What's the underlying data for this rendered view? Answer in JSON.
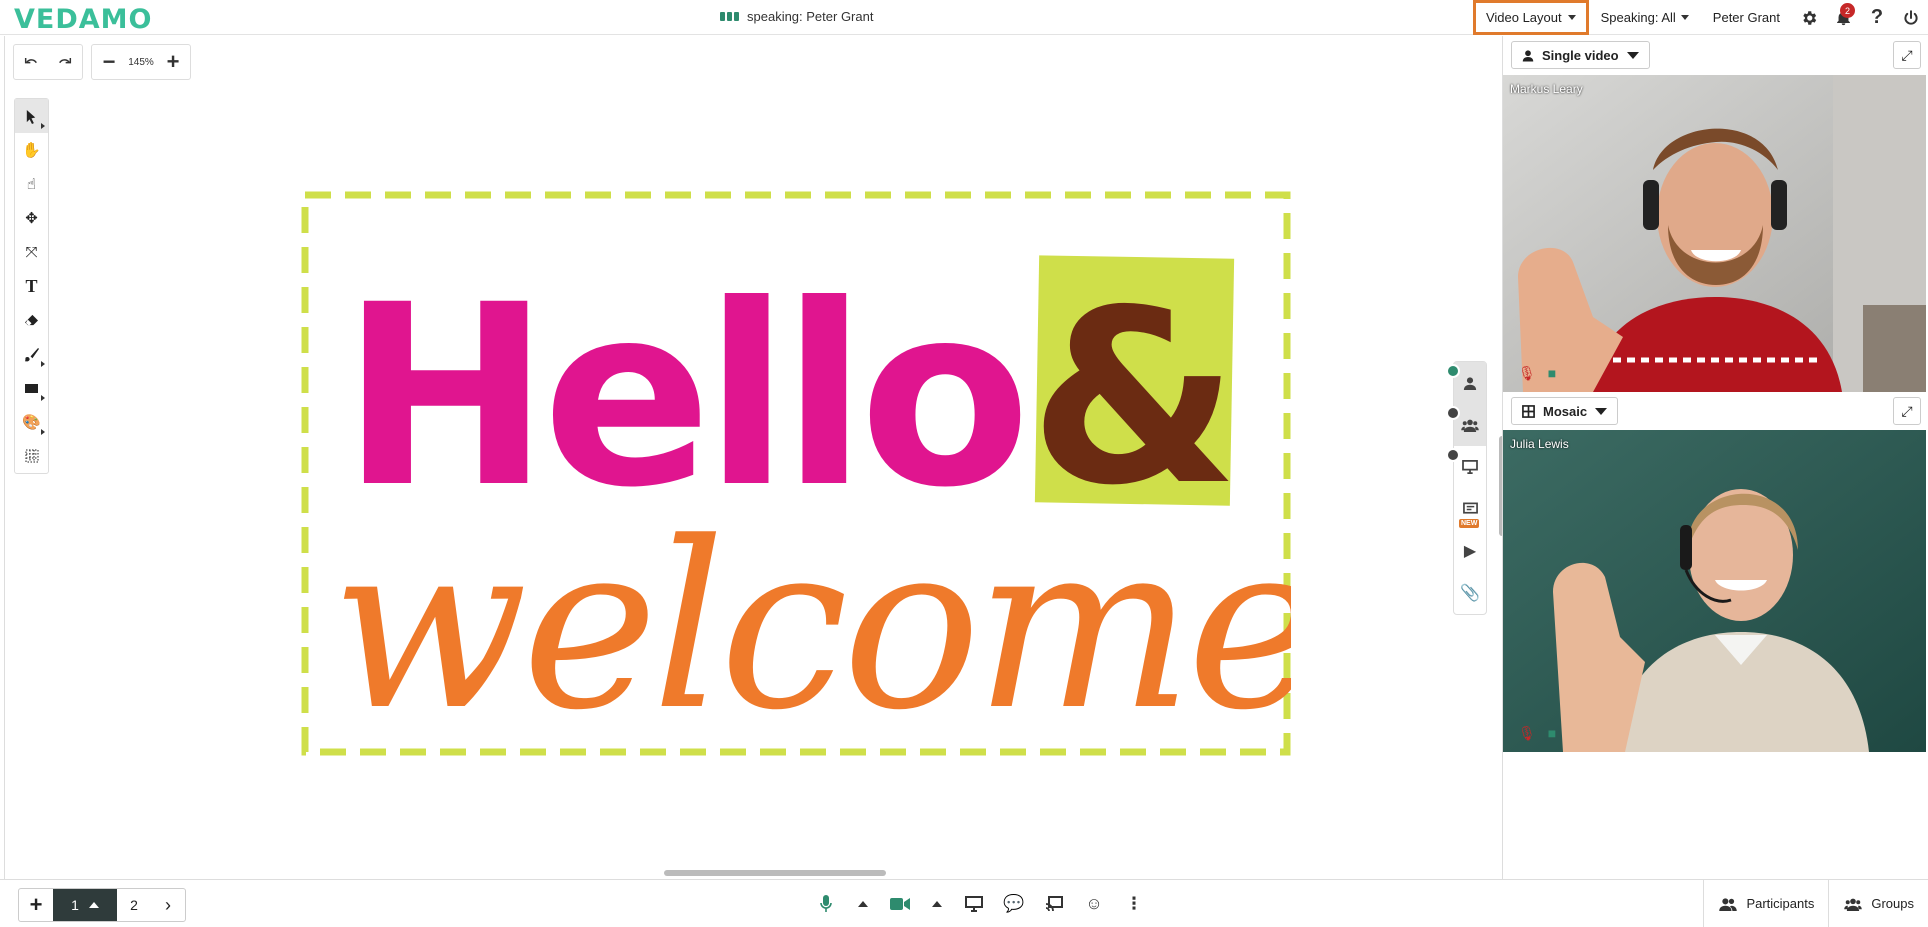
{
  "app": {
    "logo": "VEDAMO"
  },
  "topbar": {
    "speaking_text": "speaking: Peter Grant",
    "video_layout": "Video Layout",
    "speaking_filter": "Speaking: All",
    "user_name": "Peter Grant",
    "notification_count": "2",
    "icons": [
      "gear-icon",
      "bell-icon",
      "help-icon",
      "power-icon"
    ]
  },
  "board": {
    "zoom": "145%",
    "tools": [
      "select",
      "hand",
      "pointer",
      "shrink",
      "expand",
      "text",
      "eraser",
      "brush",
      "rectangle",
      "color",
      "grid"
    ],
    "content": {
      "line1": "Hello",
      "amp": "&",
      "line2": "welcome",
      "colors": {
        "pink": "#e0158f",
        "orange": "#ef7a2b",
        "lime": "#cfdf4a",
        "brown": "#6b2b12"
      }
    }
  },
  "sidetabs": {
    "new_badge": "NEW"
  },
  "video_panel": {
    "top_dropdown": "Single video",
    "bottom_dropdown": "Mosaic",
    "participants": [
      {
        "name": "Markus Leary"
      },
      {
        "name": "Julia Lewis"
      }
    ]
  },
  "bottombar": {
    "current_page": "1",
    "next_page": "2",
    "participants_label": "Participants",
    "groups_label": "Groups"
  }
}
